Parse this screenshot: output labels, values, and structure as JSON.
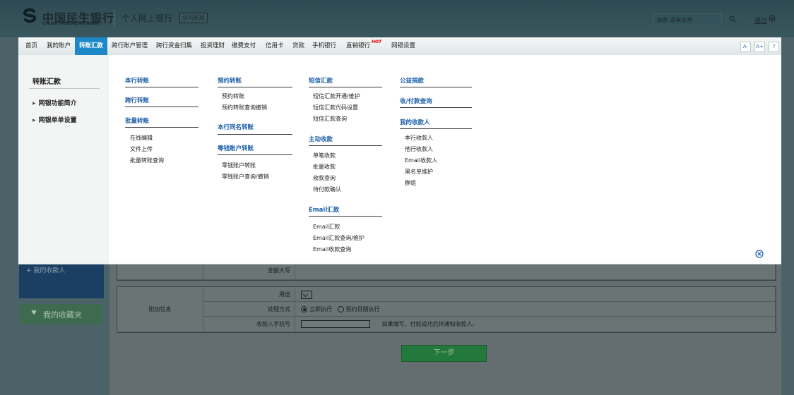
{
  "header": {
    "bank_name_cn": "中国民生银行",
    "bank_name_en": "CHINA MINSHENG BANK",
    "subtitle": "个人网上银行",
    "old_version": "访问新版",
    "search_placeholder": "搜索 菜单名称",
    "logout": "退出"
  },
  "nav": {
    "items": [
      "首页",
      "我的账户",
      "转账汇款",
      "跨行账户管理",
      "跨行资金归集",
      "投资理财",
      "缴费支付",
      "信用卡",
      "贷款",
      "手机银行",
      "直销银行",
      "网银设置"
    ],
    "hot_badge": "HOT",
    "tools": [
      "A-",
      "A+",
      "?"
    ]
  },
  "mega": {
    "left": {
      "title": "转账汇款",
      "links": [
        "网银功能简介",
        "网银单单设置"
      ]
    },
    "col1": {
      "title1": "本行转账",
      "title2": "跨行转账",
      "title3": "批量转账",
      "items": [
        "在线编辑",
        "文件上传",
        "批量转账查询"
      ]
    },
    "col2": {
      "title1": "预约转账",
      "items1": [
        "预约转账",
        "预约转账查询撤销"
      ],
      "title2": "本行同名转账",
      "title3": "零钱账户转账",
      "items3": [
        "零钱账户转账",
        "零钱账户查询/撤销"
      ]
    },
    "col3": {
      "title1": "短信汇款",
      "items1": [
        "短信汇款开通/维护",
        "短信汇款代码设置",
        "短信汇款查询"
      ],
      "title2": "主动收款",
      "items2": [
        "单笔收款",
        "批量收款",
        "收款查询",
        "待付款确认"
      ],
      "title3": "Email汇款",
      "items3": [
        "Email汇款",
        "Email汇款查询/维护",
        "Email收款查询"
      ]
    },
    "col4": {
      "title1": "公益捐款",
      "title2": "收/付款查询",
      "title3": "我的收款人",
      "items3": [
        "本行收款人",
        "他行收款人",
        "Email收款人",
        "黑名单维护",
        "群组"
      ]
    }
  },
  "sidebar": {
    "payees": "我的收款人",
    "favorites": "我的收藏夹"
  },
  "form": {
    "amount_upper": "金额大写",
    "section_extra": "附加信息",
    "purpose": "用途",
    "mode": "处理方式",
    "mode_now": "立即执行",
    "mode_scheduled": "预约日期执行",
    "mobile": "收款人手机号",
    "mobile_hint": "如果填写，付款成功后将通知收款人。",
    "next": "下一步"
  },
  "colors": {
    "accent": "#1c88c7",
    "menu_title": "#1c5ea8",
    "hot": "#e60000",
    "button": "#23793c"
  }
}
